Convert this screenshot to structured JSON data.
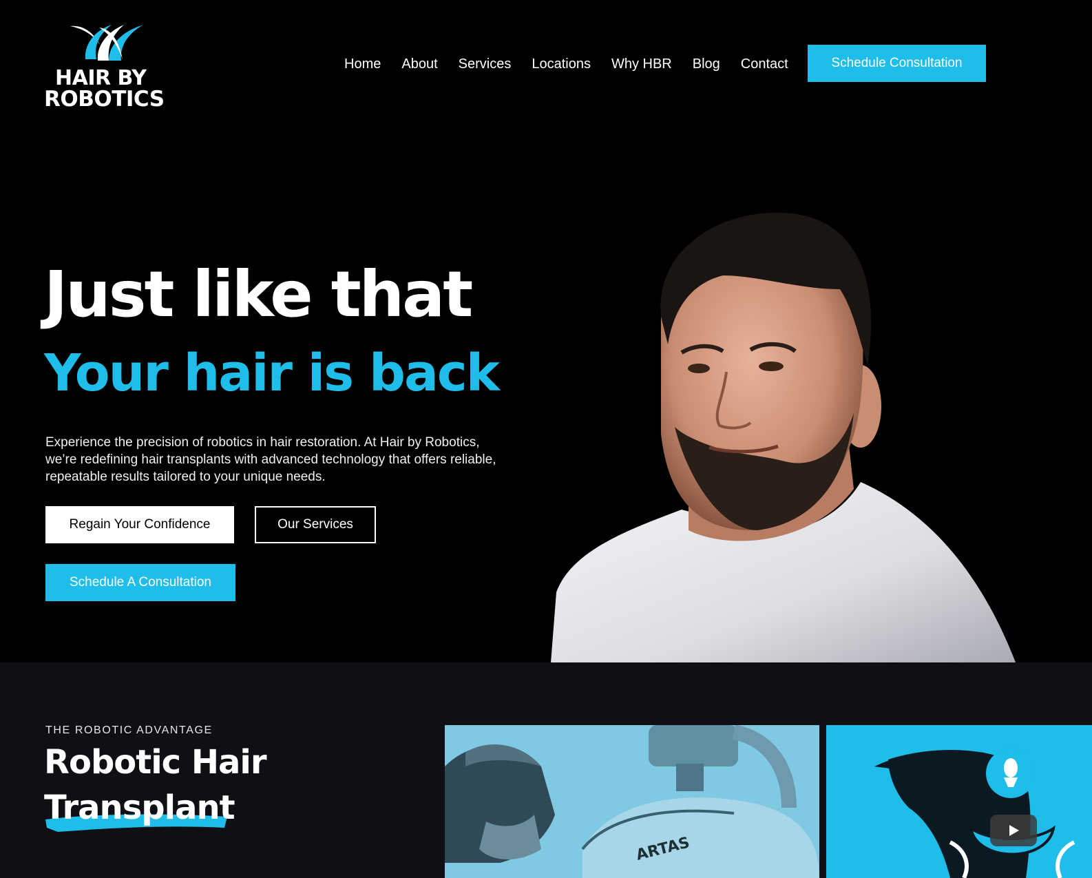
{
  "brand": {
    "line1": "HAIR BY",
    "line2": "ROBOTICS",
    "accent_color": "#1fbde9"
  },
  "nav": {
    "items": [
      {
        "label": "Home"
      },
      {
        "label": "About"
      },
      {
        "label": "Services"
      },
      {
        "label": "Locations"
      },
      {
        "label": "Why HBR"
      },
      {
        "label": "Blog"
      },
      {
        "label": "Contact"
      }
    ],
    "cta_label": "Schedule Consultation"
  },
  "hero": {
    "title": "Just like that",
    "subtitle": "Your hair is back",
    "description": "Experience the precision of robotics in hair restoration. At Hair by Robotics, we’re redefining hair transplants with advanced technology that offers reliable, repeatable results tailored to your unique needs.",
    "primary_button": "Regain Your Confidence",
    "secondary_button": "Our Services",
    "consult_button": "Schedule A Consultation"
  },
  "advantage": {
    "eyebrow": "THE ROBOTIC ADVANTAGE",
    "title_line1": "Robotic Hair",
    "title_line2": "Transplant",
    "machine_label": "ARTAS"
  },
  "icons": [
    "logo-mark-icon",
    "play-icon"
  ]
}
